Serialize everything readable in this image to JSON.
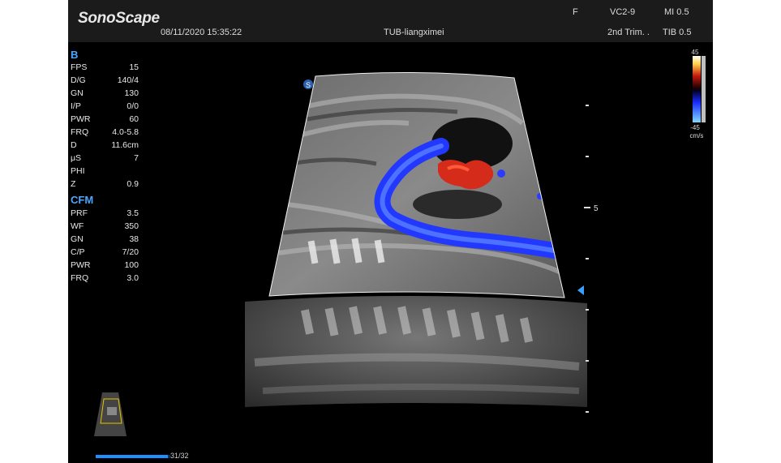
{
  "header": {
    "logo": "SonoScape",
    "datetime": "08/11/2020 15:35:22",
    "patient": "TUB-liangximei",
    "focus": "F",
    "probe": "VC2-9",
    "preset": "2nd Trim. .",
    "mi": "MI 0.5",
    "tib": "TIB 0.5"
  },
  "b_mode": {
    "title": "B",
    "params": [
      {
        "label": "FPS",
        "value": "15"
      },
      {
        "label": "D/G",
        "value": "140/4"
      },
      {
        "label": "GN",
        "value": "130"
      },
      {
        "label": "I/P",
        "value": "0/0"
      },
      {
        "label": "PWR",
        "value": "60"
      },
      {
        "label": "FRQ",
        "value": "4.0-5.8"
      },
      {
        "label": "D",
        "value": "11.6cm"
      },
      {
        "label": "μS",
        "value": "7"
      },
      {
        "label": "PHI",
        "value": ""
      },
      {
        "label": "Z",
        "value": "0.9"
      }
    ]
  },
  "cfm_mode": {
    "title": "CFM",
    "params": [
      {
        "label": "PRF",
        "value": "3.5"
      },
      {
        "label": "WF",
        "value": "350"
      },
      {
        "label": "GN",
        "value": "38"
      },
      {
        "label": "C/P",
        "value": "7/20"
      },
      {
        "label": "PWR",
        "value": "100"
      },
      {
        "label": "FRQ",
        "value": "3.0"
      }
    ]
  },
  "color_scale": {
    "max": "45",
    "min": "-45",
    "unit": "cm/s",
    "positive_color": "#d42b1a",
    "negative_color": "#2b4bff"
  },
  "depth_scale": {
    "label_5": "5"
  },
  "cine": {
    "progress_label": "31/32",
    "frame": 31,
    "total": 32
  },
  "colors": {
    "header_bg": "#1b1b1b",
    "accent": "#4aa6ff"
  }
}
